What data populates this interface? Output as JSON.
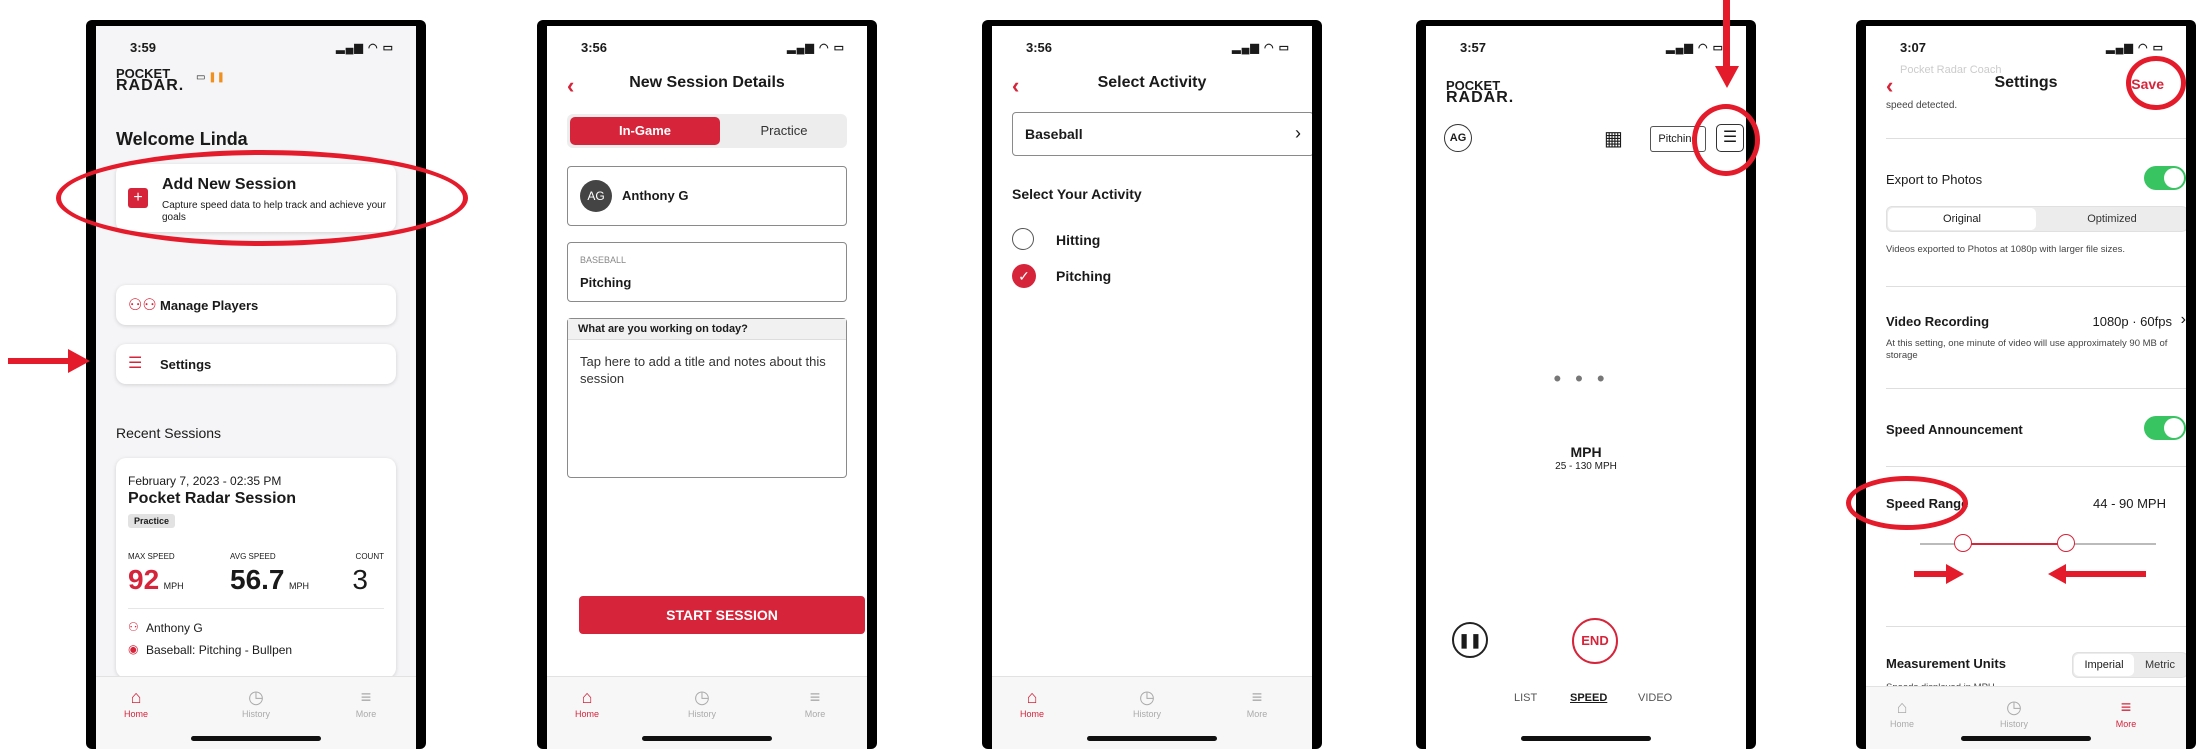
{
  "phone1": {
    "time": "3:59",
    "logo_top": "POCKET",
    "logo_bottom": "RADAR.",
    "welcome": "Welcome Linda",
    "add_session_title": "Add New Session",
    "add_session_desc": "Capture speed data to help track and achieve your goals",
    "manage_players": "Manage Players",
    "settings": "Settings",
    "recent_sessions": "Recent Sessions",
    "recent": {
      "date": "February 7, 2023 - 02:35 PM",
      "title": "Pocket Radar Session",
      "badge": "Practice",
      "max_label": "MAX SPEED",
      "max_value": "92",
      "max_unit": "MPH",
      "avg_label": "AVG SPEED",
      "avg_value": "56.7",
      "avg_unit": "MPH",
      "count_label": "COUNT",
      "count_value": "3",
      "player": "Anthony G",
      "activity": "Baseball: Pitching - Bullpen"
    },
    "tabs": [
      "Home",
      "History",
      "More"
    ]
  },
  "phone2": {
    "time": "3:56",
    "title": "New Session Details",
    "seg_active": "In-Game",
    "seg_inactive": "Practice",
    "player_initials": "AG",
    "player_name": "Anthony G",
    "activity_label": "BASEBALL",
    "activity_value": "Pitching",
    "notes_label": "What are you working on today?",
    "notes_placeholder": "Tap here to add a title and notes about this session",
    "start_button": "START SESSION",
    "tabs": [
      "Home",
      "History",
      "More"
    ]
  },
  "phone3": {
    "time": "3:56",
    "title": "Select Activity",
    "sport": "Baseball",
    "section": "Select Your Activity",
    "options": [
      {
        "label": "Hitting",
        "selected": false
      },
      {
        "label": "Pitching",
        "selected": true
      }
    ],
    "tabs": [
      "Home",
      "History",
      "More"
    ]
  },
  "phone4": {
    "time": "3:57",
    "logo_top": "POCKET",
    "logo_bottom": "RADAR.",
    "initials": "AG",
    "activity_chip": "Pitching",
    "unit": "MPH",
    "range": "25 - 130 MPH",
    "end_button": "END",
    "modes": [
      "LIST",
      "SPEED",
      "VIDEO"
    ],
    "active_mode": "SPEED"
  },
  "phone5": {
    "time": "3:07",
    "title": "Settings",
    "save": "Save",
    "faded_text": "Pocket Radar Coach",
    "faded_desc": "speed detected.",
    "export_label": "Export to Photos",
    "export_opts": [
      "Original",
      "Optimized"
    ],
    "export_desc": "Videos exported to Photos at 1080p with larger file sizes.",
    "video_label": "Video Recording",
    "video_value": "1080p · 60fps",
    "video_desc": "At this setting, one minute of video will use approximately 90 MB of storage",
    "speed_ann": "Speed Announcement",
    "speed_range_label": "Speed Range",
    "speed_range_value": "44 - 90 MPH",
    "speed_range_min": 44,
    "speed_range_max": 90,
    "units_label": "Measurement Units",
    "units_opts": [
      "Imperial",
      "Metric"
    ],
    "units_desc": "Speeds displayed in MPH.",
    "tabs": [
      "Home",
      "History",
      "More"
    ]
  },
  "colors": {
    "accent": "#d6243a",
    "annotation": "#e41b2a",
    "toggle_on": "#37c461"
  }
}
